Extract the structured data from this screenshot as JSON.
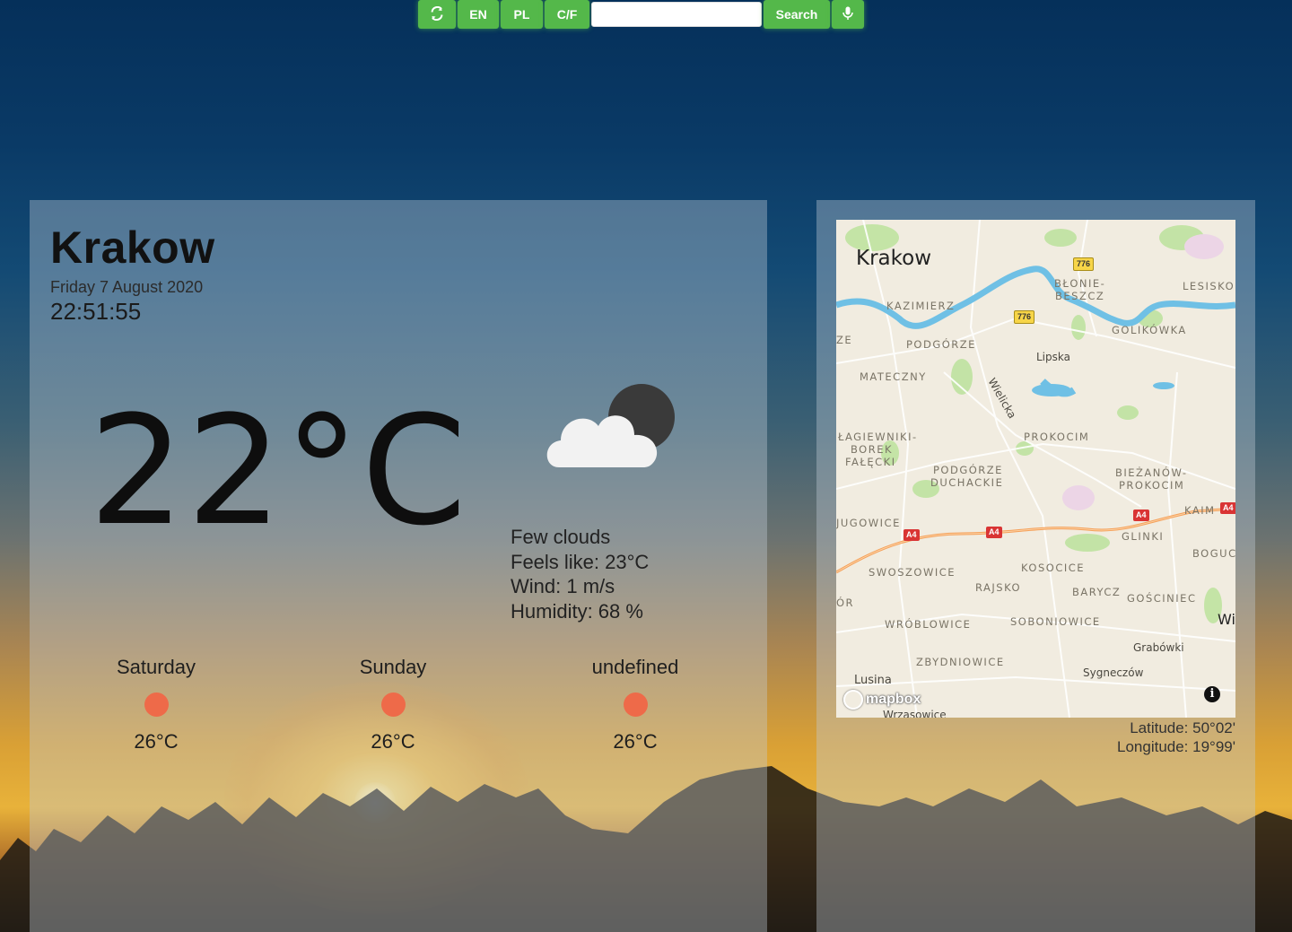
{
  "toolbar": {
    "refresh_icon": "refresh-icon",
    "lang_en": "EN",
    "lang_pl": "PL",
    "units_toggle": "C/F",
    "search_value": "",
    "search_placeholder": "",
    "search_label": "Search",
    "mic_icon": "microphone-icon",
    "accent_color": "#54b84a"
  },
  "weather": {
    "city": "Krakow",
    "date": "Friday 7 August 2020",
    "time": "22:51:55",
    "temperature": "22°C",
    "icon": "few-clouds-night-icon",
    "description": "Few clouds",
    "feels_like": "Feels like: 23°C",
    "wind": "Wind: 1 m/s",
    "humidity": "Humidity: 68 %"
  },
  "forecast": [
    {
      "day": "Saturday",
      "temp": "26°C",
      "icon": "sun-dot-icon"
    },
    {
      "day": "Sunday",
      "temp": "26°C",
      "icon": "sun-dot-icon"
    },
    {
      "day": "undefined",
      "temp": "26°C",
      "icon": "sun-dot-icon"
    }
  ],
  "map": {
    "city_label": "Krakow",
    "labels": {
      "blonie": "BŁONIE-",
      "beszcz": "BESZCZ",
      "lesisko": "LESISKO",
      "kazimierz": "KAZIMIERZ",
      "golikowka": "GOLIKÓWKA",
      "podgorze": "PODGÓRZE",
      "ze": "ZE",
      "lipska": "Lipska",
      "mateczny": "MATECZNY",
      "wielicka": "Wielicka",
      "lagiewniki": "ŁAGIEWNIKI-",
      "borek": "BOREK",
      "falecki": "FAŁĘCKI",
      "prokocim": "PROKOCIM",
      "podgorze_duchackie_1": "PODGÓRZE",
      "podgorze_duchackie_2": "DUCHACKIE",
      "biezanow_1": "BIEŻANÓW-",
      "biezanow_2": "PROKOCIM",
      "jugowice": "JUGOWICE",
      "kaim": "KAIM",
      "glinki": "GLINKI",
      "bogucice": "BOGUCI",
      "swoszowice": "SWOSZOWICE",
      "kosocice": "KOSOCICE",
      "rajsko": "RAJSKO",
      "barycz": "BARYCZ",
      "goscieniec": "GOŚCINIEC",
      "or": "ÓR",
      "wroblowice": "WRÓBLOWICE",
      "sobiniowice": "SOBONIOWICE",
      "wi": "Wi",
      "grabowki": "Grabówki",
      "zbydniowice": "ZBYDNIOWICE",
      "sygneczow": "Sygneczów",
      "lusina": "Lusina",
      "wrzasowice": "Wrzasowice"
    },
    "shields": {
      "r776": "776",
      "a4": "A4"
    },
    "attribution": "mapbox",
    "info": "i"
  },
  "coords": {
    "latitude": "Latitude: 50°02'",
    "longitude": "Longitude: 19°99'"
  }
}
